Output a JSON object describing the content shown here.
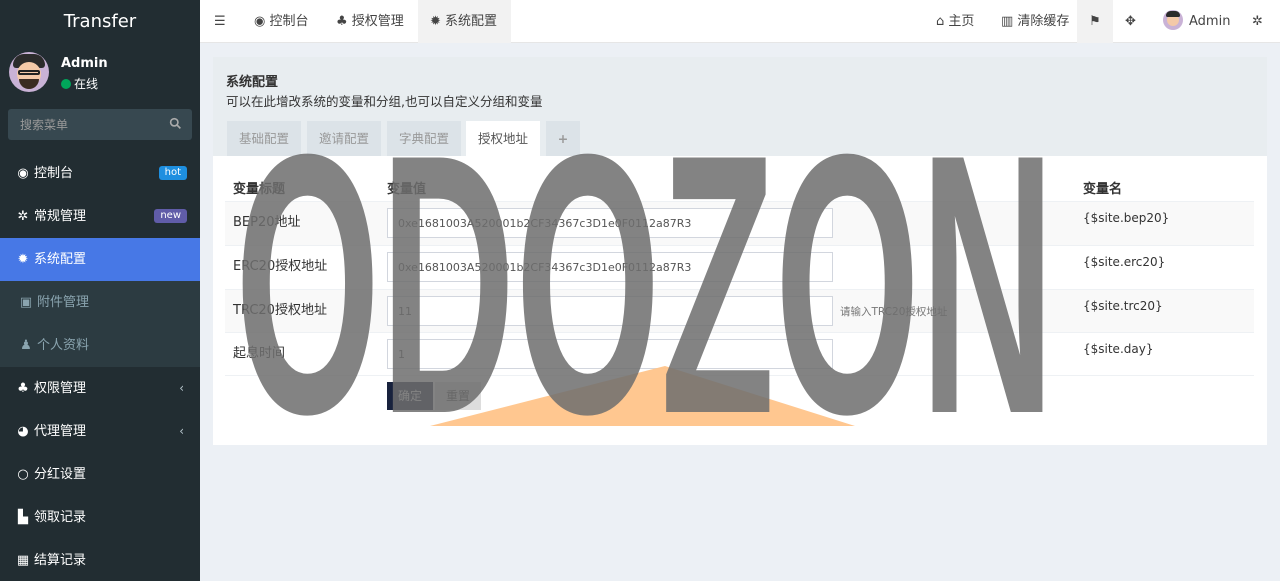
{
  "app": {
    "title": "Transfer"
  },
  "user": {
    "name": "Admin",
    "status": "在线"
  },
  "search": {
    "placeholder": "搜索菜单"
  },
  "menu": [
    {
      "label": "控制台",
      "icon": "dashboard-icon",
      "badge": "hot"
    },
    {
      "label": "常规管理",
      "icon": "cogs-icon",
      "badge": "new"
    },
    {
      "label": "系统配置",
      "icon": "gear-icon",
      "active": true
    },
    {
      "label": "附件管理",
      "icon": "image-icon"
    },
    {
      "label": "个人资料",
      "icon": "user-icon"
    },
    {
      "label": "权限管理",
      "icon": "group-icon",
      "chevron": "‹"
    },
    {
      "label": "代理管理",
      "icon": "user-circle-icon",
      "chevron": "‹"
    },
    {
      "label": "分红设置",
      "icon": "circle-icon"
    },
    {
      "label": "领取记录",
      "icon": "list-icon"
    },
    {
      "label": "结算记录",
      "icon": "calendar-icon"
    }
  ],
  "topnav": {
    "tabs": [
      {
        "label": "控制台",
        "icon": "dashboard-icon"
      },
      {
        "label": "授权管理",
        "icon": "group-icon"
      },
      {
        "label": "系统配置",
        "icon": "gear-icon"
      }
    ],
    "home": "主页",
    "clear_cache": "清除缓存",
    "user": "Admin"
  },
  "page": {
    "title": "系统配置",
    "description": "可以在此增改系统的变量和分组,也可以自定义分组和变量",
    "tabs": [
      "基础配置",
      "邀请配置",
      "字典配置",
      "授权地址",
      "+"
    ],
    "table_headers": {
      "title": "变量标题",
      "value": "变量值",
      "name": "变量名"
    },
    "rows": [
      {
        "label": "BEP20地址",
        "value": "0xe1681003A520001b2CF34367c3D1e0F0112a87R3",
        "tip": "",
        "var": "{$site.bep20}"
      },
      {
        "label": "ERC20授权地址",
        "value": "0xe1681003A520001b2CF34367c3D1e0F0112a87R3",
        "tip": "",
        "var": "{$site.erc20}"
      },
      {
        "label": "TRC20授权地址",
        "value": "11",
        "tip": "请输入TRC20授权地址",
        "var": "{$site.trc20}"
      },
      {
        "label": "起息时间",
        "value": "1",
        "tip": "",
        "var": "{$site.day}"
      }
    ],
    "buttons": {
      "submit": "确定",
      "reset": "重置"
    }
  },
  "watermark": {
    "text": "ODOZON",
    "color": "#7a7a7a",
    "accent": "#ffc48a"
  }
}
